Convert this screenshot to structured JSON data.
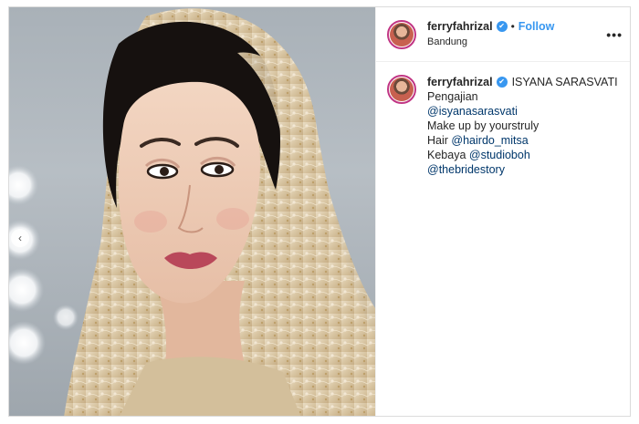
{
  "post": {
    "username": "ferryfahrizal",
    "dot": "•",
    "follow_label": "Follow",
    "location": "Bandung",
    "more_label": "•••"
  },
  "caption": {
    "username": "ferryfahrizal",
    "title": "ISYANA SARASVATI",
    "line1": "Pengajian",
    "mention1": "@isyanasarasvati",
    "line2": "Make up by yourstruly",
    "hair_prefix": "Hair ",
    "mention2": "@hairdo_mitsa",
    "kebaya_prefix": "Kebaya ",
    "mention3": "@studioboh",
    "mention4": "@thebridestory"
  },
  "icons": {
    "verified": "✔",
    "prev": "‹"
  },
  "colors": {
    "accent": "#3897f0",
    "link": "#00376b",
    "story_ring": "#c13584",
    "veil": "#d9c7a7"
  }
}
